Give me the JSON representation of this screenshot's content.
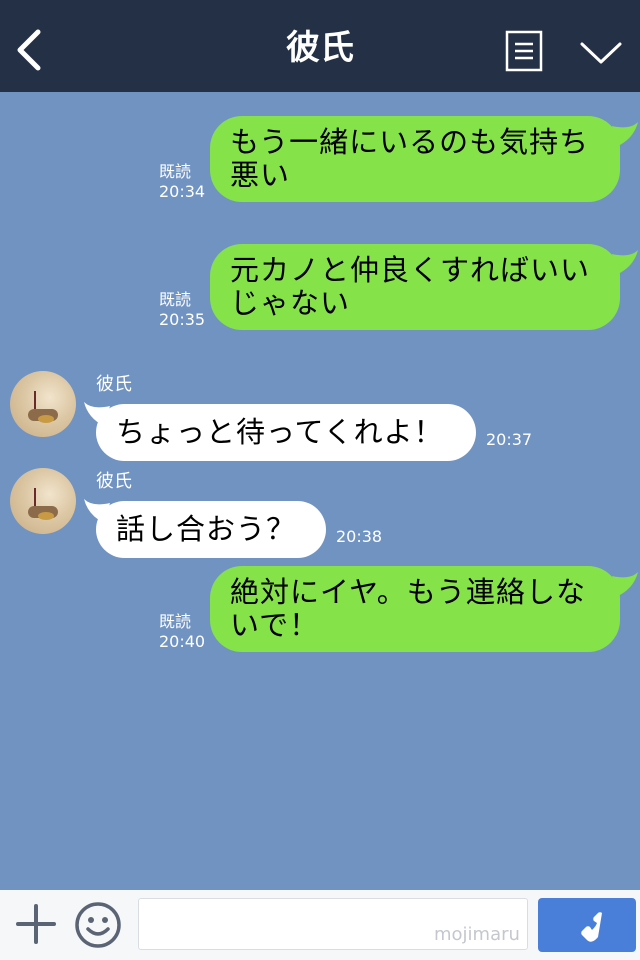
{
  "header": {
    "title": "彼氏",
    "icons": [
      "back-icon",
      "menu-icon",
      "collapse-icon"
    ]
  },
  "messages": [
    {
      "direction": "out",
      "text": "もう一緒にいるのも気持ち悪い",
      "read": "既読",
      "time": "20:34"
    },
    {
      "direction": "out",
      "text": "元カノと仲良くすればいいじゃない",
      "read": "既読",
      "time": "20:35"
    },
    {
      "direction": "in",
      "sender": "彼氏",
      "text": "ちょっと待ってくれよ！",
      "time": "20:37"
    },
    {
      "direction": "in",
      "sender": "彼氏",
      "text": "話し合おう？",
      "time": "20:38"
    },
    {
      "direction": "out",
      "text": "絶対にイヤ。もう連絡しないで！",
      "read": "既読",
      "time": "20:40"
    }
  ],
  "footer": {
    "input_value": "",
    "watermark": "mojimaru",
    "icons": [
      "plus-icon",
      "emoji-icon",
      "phone-icon"
    ]
  },
  "colors": {
    "header": "#243045",
    "background": "#7193c2",
    "outgoing_bubble": "#85e249",
    "incoming_bubble": "#ffffff",
    "call_button": "#4a7fd9"
  }
}
